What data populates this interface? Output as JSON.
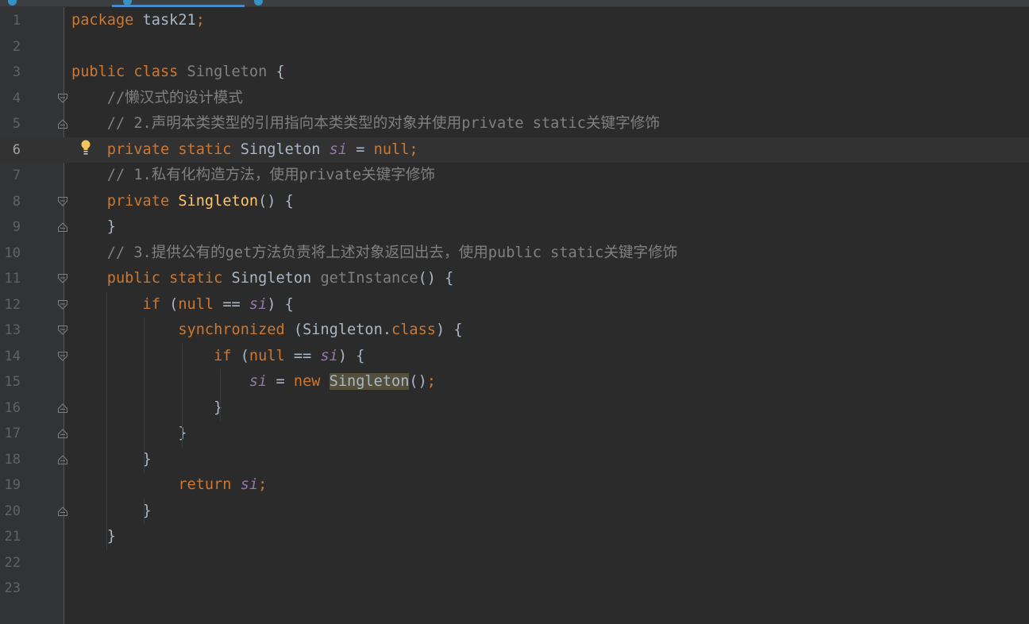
{
  "editor": {
    "language": "java",
    "caret_line": 6,
    "lines": [
      {
        "n": "1",
        "tokens": [
          [
            "kw",
            "package"
          ],
          [
            "gray",
            " task21"
          ],
          [
            "kw",
            ";"
          ]
        ]
      },
      {
        "n": "2",
        "tokens": []
      },
      {
        "n": "3",
        "tokens": [
          [
            "kw",
            "public class "
          ],
          [
            "unused",
            "Singleton"
          ],
          [
            "gray",
            " {"
          ]
        ]
      },
      {
        "n": "4",
        "tokens": [
          [
            "cm",
            "    //懒汉式的设计模式"
          ]
        ]
      },
      {
        "n": "5",
        "tokens": [
          [
            "cm",
            "    // 2.声明本类类型的引用指向本类类型的对象并使用private static关键字修饰"
          ]
        ]
      },
      {
        "n": "6",
        "tokens": [
          [
            "kw",
            "    private static "
          ],
          [
            "gray",
            "Singleton "
          ],
          [
            "fld",
            "si"
          ],
          [
            "gray",
            " = "
          ],
          [
            "kw",
            "null;"
          ]
        ]
      },
      {
        "n": "7",
        "tokens": [
          [
            "cm",
            "    // 1.私有化构造方法，使用private关键字修饰"
          ]
        ]
      },
      {
        "n": "8",
        "tokens": [
          [
            "kw",
            "    private "
          ],
          [
            "fn",
            "Singleton"
          ],
          [
            "gray",
            "() {"
          ]
        ]
      },
      {
        "n": "9",
        "tokens": [
          [
            "gray",
            "    }"
          ]
        ]
      },
      {
        "n": "10",
        "tokens": [
          [
            "cm",
            "    // 3.提供公有的get方法负责将上述对象返回出去，使用public static关键字修饰"
          ]
        ]
      },
      {
        "n": "11",
        "tokens": [
          [
            "kw",
            "    public static "
          ],
          [
            "gray",
            "Singleton "
          ],
          [
            "unused",
            "getInstance"
          ],
          [
            "gray",
            "() {"
          ]
        ]
      },
      {
        "n": "12",
        "tokens": [
          [
            "kw",
            "        if "
          ],
          [
            "gray",
            "("
          ],
          [
            "kw",
            "null"
          ],
          [
            "gray",
            " == "
          ],
          [
            "fld",
            "si"
          ],
          [
            "gray",
            ") {"
          ]
        ]
      },
      {
        "n": "13",
        "tokens": [
          [
            "kw",
            "            synchronized "
          ],
          [
            "gray",
            "(Singleton."
          ],
          [
            "kw",
            "class"
          ],
          [
            "gray",
            ") {"
          ]
        ]
      },
      {
        "n": "14",
        "tokens": [
          [
            "kw",
            "                if "
          ],
          [
            "gray",
            "("
          ],
          [
            "kw",
            "null"
          ],
          [
            "gray",
            " == "
          ],
          [
            "fld",
            "si"
          ],
          [
            "gray",
            ") {"
          ]
        ]
      },
      {
        "n": "15",
        "tokens": [
          [
            "fld",
            "                    si"
          ],
          [
            "gray",
            " = "
          ],
          [
            "kw",
            "new "
          ],
          [
            "usage",
            "Singleton"
          ],
          [
            "gray",
            "()"
          ],
          [
            "kw",
            ";"
          ]
        ]
      },
      {
        "n": "16",
        "tokens": [
          [
            "gray",
            "                }"
          ]
        ]
      },
      {
        "n": "17",
        "tokens": [
          [
            "gray",
            "            }"
          ]
        ]
      },
      {
        "n": "18",
        "tokens": [
          [
            "gray",
            "        }"
          ]
        ]
      },
      {
        "n": "19",
        "tokens": [
          [
            "kw",
            "            return "
          ],
          [
            "fld",
            "si"
          ],
          [
            "kw",
            ";"
          ]
        ]
      },
      {
        "n": "20",
        "tokens": [
          [
            "gray",
            "        }"
          ]
        ]
      },
      {
        "n": "21",
        "tokens": [
          [
            "gray",
            "    }"
          ]
        ]
      },
      {
        "n": "22",
        "tokens": []
      },
      {
        "n": "23",
        "tokens": []
      }
    ],
    "fold_open_lines": [
      4,
      8,
      11,
      12,
      13,
      14
    ],
    "fold_close_lines": [
      5,
      9,
      16,
      17,
      18,
      20
    ],
    "intention_bulb_line": 6,
    "icons": {
      "fold_open": "fold-open-icon",
      "fold_close": "fold-close-icon",
      "bulb": "lightbulb-icon"
    },
    "colors": {
      "background": "#2b2b2b",
      "keyword": "#cc7832",
      "comment": "#808080",
      "field": "#9876aa",
      "method": "#ffc66d",
      "text": "#a9b7c6"
    }
  }
}
